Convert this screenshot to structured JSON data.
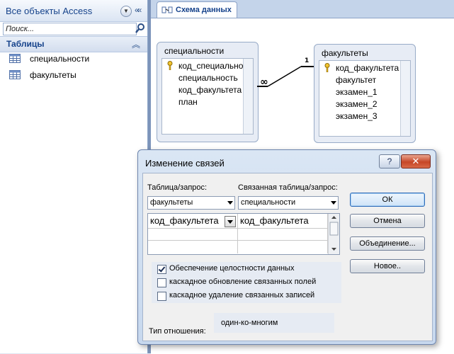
{
  "nav": {
    "title": "Все объекты Access",
    "search_placeholder": "Поиск...",
    "group_label": "Таблицы",
    "items": [
      {
        "label": "специальности"
      },
      {
        "label": "факультеты"
      }
    ]
  },
  "document": {
    "tab_label": "Схема данных",
    "tables": [
      {
        "title": "специальности",
        "fields": [
          "код_специальности",
          "специальность",
          "код_факультета",
          "план"
        ]
      },
      {
        "title": "факультеты",
        "fields": [
          "код_факультета",
          "факультет",
          "экзамен_1",
          "экзамен_2",
          "экзамен_3"
        ]
      }
    ],
    "relationship": {
      "one_label": "1",
      "many_label": "∞"
    }
  },
  "dialog": {
    "title": "Изменение связей",
    "help_label": "?",
    "close_label": "✕",
    "table_query_label": "Таблица/запрос:",
    "related_table_label": "Связанная таблица/запрос:",
    "table_value": "факультеты",
    "related_value": "специальности",
    "grid_row": {
      "left": "код_факультета",
      "right": "код_факультета"
    },
    "checkboxes": [
      {
        "label": "Обеспечение целостности данных",
        "checked": true
      },
      {
        "label": "каскадное обновление связанных полей",
        "checked": false
      },
      {
        "label": "каскадное удаление связанных записей",
        "checked": false
      }
    ],
    "relation_type_label": "Тип отношения:",
    "relation_type_value": "один-ко-многим",
    "buttons": {
      "ok": "ОК",
      "cancel": "Отмена",
      "join": "Объединение...",
      "new": "Новое.."
    }
  },
  "colors": {
    "accent": "#15428b",
    "panel": "#c4d4ea",
    "close": "#c64626"
  }
}
